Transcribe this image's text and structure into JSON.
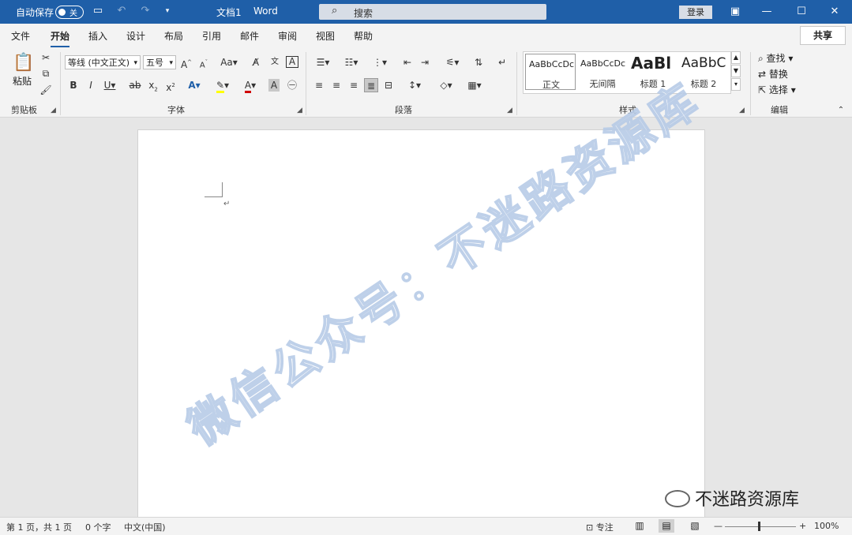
{
  "titlebar": {
    "autosave_label": "自动保存",
    "autosave_state": "关",
    "doc_title": "文档1",
    "app_name": "Word",
    "search_placeholder": "搜索",
    "login": "登录"
  },
  "tabs": [
    "文件",
    "开始",
    "插入",
    "设计",
    "布局",
    "引用",
    "邮件",
    "审阅",
    "视图",
    "帮助"
  ],
  "active_tab": "开始",
  "share_label": "共享",
  "ribbon": {
    "clipboard": {
      "paste_label": "粘贴",
      "group_label": "剪贴板"
    },
    "font": {
      "font_name": "等线 (中文正文)",
      "font_size": "五号",
      "change_case": "Aa",
      "group_label": "字体"
    },
    "paragraph": {
      "group_label": "段落"
    },
    "styles": {
      "items": [
        {
          "preview": "AaBbCcDc",
          "name": "正文"
        },
        {
          "preview": "AaBbCcDc",
          "name": "无间隔"
        },
        {
          "preview": "AaBl",
          "name": "标题 1"
        },
        {
          "preview": "AaBbC",
          "name": "标题 2"
        }
      ],
      "group_label": "样式"
    },
    "editing": {
      "find": "查找",
      "replace": "替换",
      "select": "选择",
      "group_label": "编辑"
    }
  },
  "document": {
    "watermark": "微信公众号：不迷路资源库",
    "brand": "不迷路资源库"
  },
  "statusbar": {
    "page": "第 1 页，共 1 页",
    "words": "0 个字",
    "language": "中文(中国)",
    "focus": "专注",
    "zoom": "100%"
  },
  "colors": {
    "titlebar": "#1f5fa8",
    "ribbon": "#f3f3f3",
    "highlight": "#ffff00",
    "font_color": "#d00000"
  }
}
